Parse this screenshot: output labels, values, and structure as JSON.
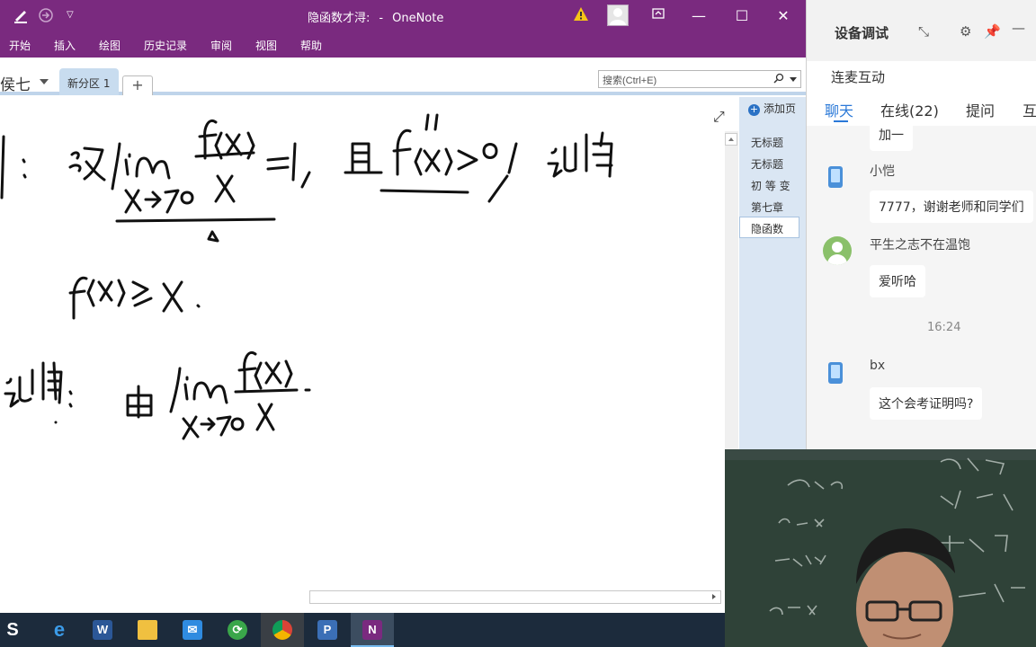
{
  "window": {
    "title": "隐函数才浔:",
    "app": "OneNote",
    "ribbon_tabs": [
      "开始",
      "插入",
      "绘图",
      "历史记录",
      "审阅",
      "视图",
      "帮助"
    ]
  },
  "notebook": {
    "name": "侯七",
    "active_section": "新分区 1",
    "add_section_label": "+",
    "search_placeholder": "搜索(Ctrl+E)"
  },
  "pages": {
    "add_label": "添加页",
    "items": [
      "无标题",
      "无标题",
      "初 等 变",
      "第七章",
      "隐函数"
    ],
    "selected_index": 4
  },
  "chat": {
    "title": "设备调试",
    "subtitle": "连麦互动",
    "tabs": [
      "聊天",
      "在线(22)",
      "提问",
      "互"
    ],
    "active_tab": 0,
    "messages": [
      {
        "text": "加一"
      },
      {
        "user": "小恺",
        "text": "7777，谢谢老师和同学们"
      },
      {
        "user": "平生之志不在温饱",
        "text": "爱听哈"
      },
      {
        "time": "16:24"
      },
      {
        "user": "bx",
        "text": "这个会考证明吗?"
      }
    ]
  },
  "taskbar": {
    "apps": [
      "start",
      "edge",
      "word",
      "file-explorer",
      "mail",
      "green-app",
      "chrome",
      "powerpoint-pres",
      "onenote"
    ],
    "active_index": 8
  },
  "colors": {
    "onenote_purple": "#7a2a7f",
    "chat_accent": "#2b79d8",
    "page_pane": "#dae6f3",
    "taskbar": "#1c2b3c"
  }
}
